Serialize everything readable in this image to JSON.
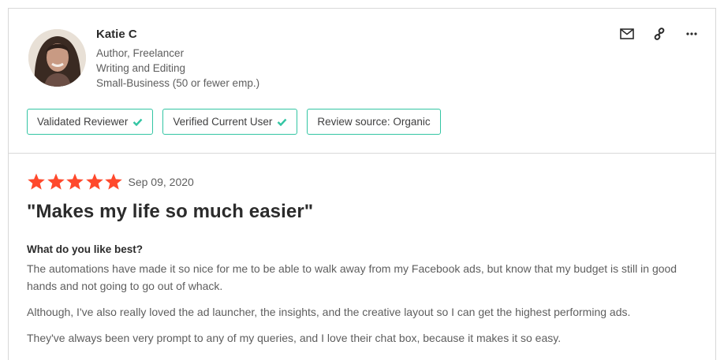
{
  "reviewer": {
    "name": "Katie C",
    "meta": [
      "Author, Freelancer",
      "Writing and Editing",
      "Small-Business (50 or fewer emp.)"
    ]
  },
  "badges": [
    {
      "label": "Validated Reviewer",
      "checked": true
    },
    {
      "label": "Verified Current User",
      "checked": true
    },
    {
      "label": "Review source: Organic",
      "checked": false
    }
  ],
  "actions": [
    "mail-icon",
    "link-icon",
    "more-icon"
  ],
  "review": {
    "rating": 5,
    "date": "Sep 09, 2020",
    "title": "\"Makes my life so much easier\"",
    "question": "What do you like best?",
    "paragraphs": [
      "The automations have made it so nice for me to be able to walk away from my Facebook ads, but know that my budget is still in good hands and not going to go out of whack.",
      "Although, I've also really loved the ad launcher, the insights, and the creative layout so I can get the highest performing ads.",
      "They've always been very prompt to any of my queries, and I love their chat box, because it makes it so easy."
    ]
  },
  "colors": {
    "star": "#ff492c",
    "badge_border": "#33c5a3",
    "check": "#33c5a3",
    "border": "#d8d8d8"
  }
}
